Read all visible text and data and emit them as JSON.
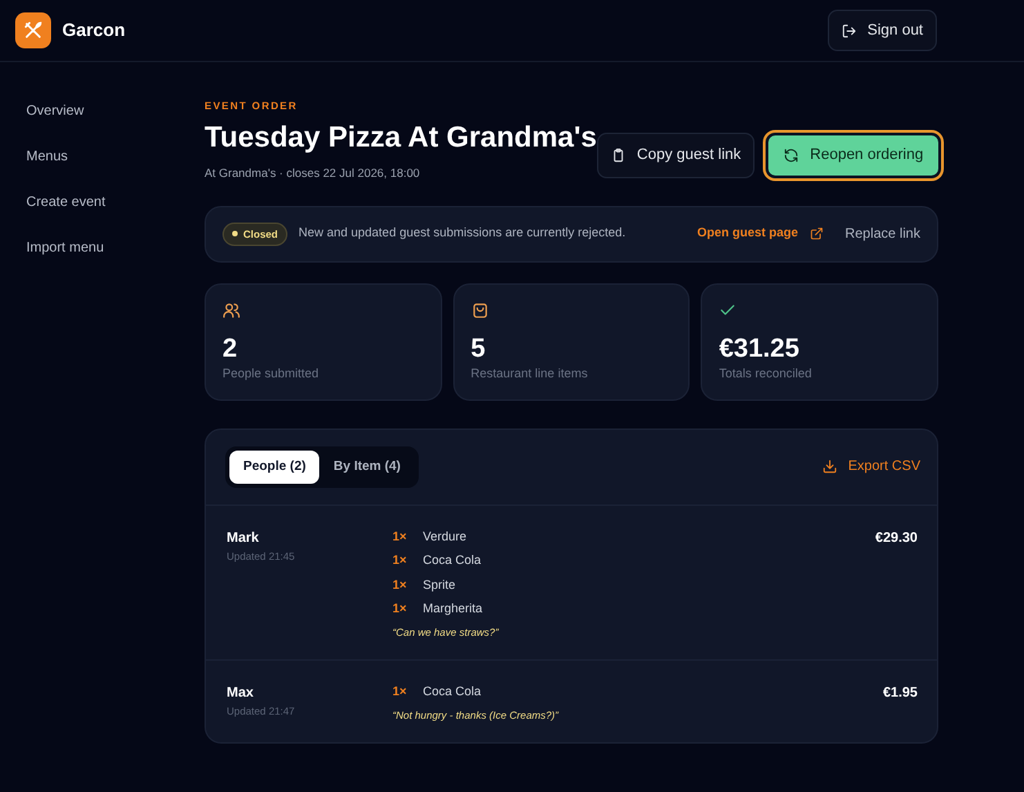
{
  "brand": "Garcon",
  "header": {
    "sign_out": "Sign out"
  },
  "sidebar": {
    "items": [
      {
        "label": "Overview"
      },
      {
        "label": "Menus"
      },
      {
        "label": "Create event"
      },
      {
        "label": "Import menu"
      }
    ]
  },
  "event": {
    "eyebrow": "EVENT ORDER",
    "title": "Tuesday Pizza At Grandma's",
    "subtitle": "At Grandma's · closes 22 Jul 2026, 18:00",
    "copy_button": "Copy guest link",
    "reopen_button": "Reopen ordering"
  },
  "status": {
    "badge": "Closed",
    "message": "New and updated guest submissions are currently rejected.",
    "open_link": "Open guest page",
    "replace_link": "Replace link"
  },
  "stats": [
    {
      "value": "2",
      "label": "People submitted"
    },
    {
      "value": "5",
      "label": "Restaurant line items"
    },
    {
      "value": "€31.25",
      "label": "Totals reconciled"
    }
  ],
  "tabs": [
    {
      "label": "People (2)",
      "selected": true
    },
    {
      "label": "By Item (4)",
      "selected": false
    }
  ],
  "export": "Export CSV",
  "people": [
    {
      "name": "Mark",
      "updated": "Updated 21:45",
      "total": "€29.30",
      "items": [
        {
          "qty": "1×",
          "name": "Verdure"
        },
        {
          "qty": "1×",
          "name": "Coca Cola"
        },
        {
          "qty": "1×",
          "name": "Sprite"
        },
        {
          "qty": "1×",
          "name": "Margherita"
        }
      ],
      "note": "“Can we have straws?”"
    },
    {
      "name": "Max",
      "updated": "Updated 21:47",
      "total": "€1.95",
      "items": [
        {
          "qty": "1×",
          "name": "Coca Cola"
        }
      ],
      "note": "“Not hungry - thanks (Ice Creams?)”"
    }
  ]
}
